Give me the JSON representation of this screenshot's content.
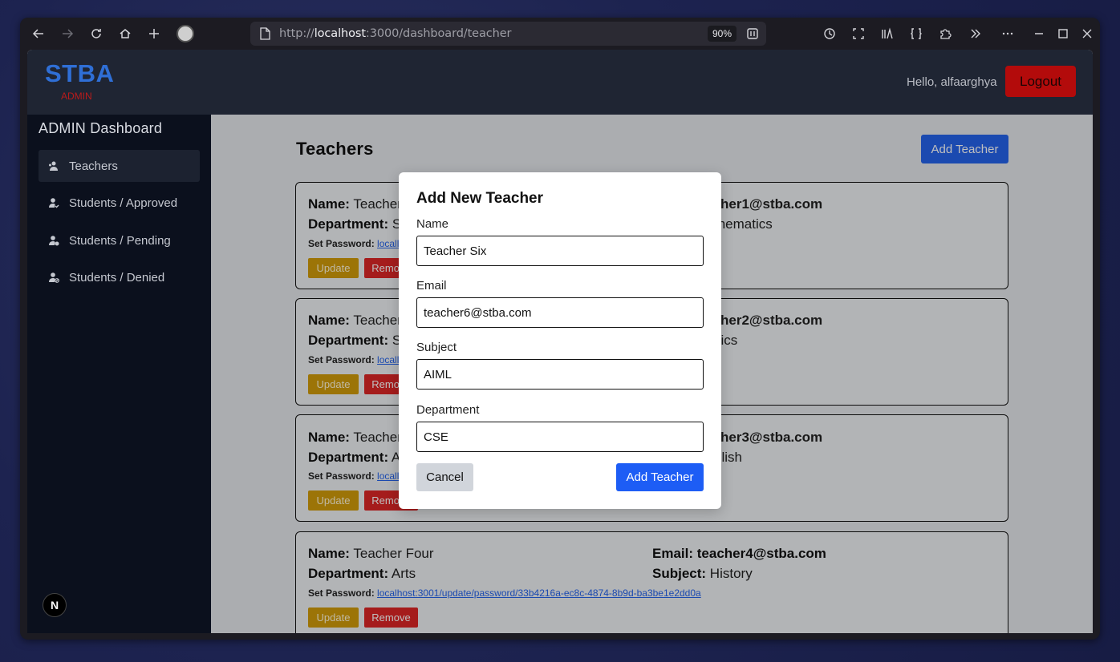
{
  "browser": {
    "url_scheme": "http://",
    "url_host": "localhost",
    "url_path": ":3000/dashboard/teacher",
    "zoom": "90%",
    "icons": [
      "back-arrow-icon",
      "forward-arrow-icon",
      "reload-icon",
      "home-icon",
      "new-tab-icon",
      "profile-avatar-icon",
      "page-icon",
      "reader-view-icon",
      "history-icon",
      "screenshot-icon",
      "library-icon",
      "dev-tools-icon",
      "extensions-icon",
      "overflow-icon",
      "menu-icon",
      "minimize-icon",
      "maximize-icon",
      "close-icon"
    ]
  },
  "header": {
    "logo": "STBA",
    "logo_sub": "ADMIN",
    "greeting": "Hello, alfaarghya",
    "logout_label": "Logout"
  },
  "sidebar": {
    "title": "ADMIN Dashboard",
    "items": [
      {
        "label": "Teachers",
        "icon": "teachers-icon",
        "active": true
      },
      {
        "label": "Students / Approved",
        "icon": "user-check-icon",
        "active": false
      },
      {
        "label": "Students / Pending",
        "icon": "user-clock-icon",
        "active": false
      },
      {
        "label": "Students / Denied",
        "icon": "user-block-icon",
        "active": false
      }
    ],
    "next_badge": "N"
  },
  "main": {
    "title": "Teachers",
    "add_button": "Add Teacher",
    "labels": {
      "name": "Name:",
      "department": "Department:",
      "email": "Email:",
      "subject": "Subject:",
      "set_password": "Set Password:",
      "update": "Update",
      "remove": "Remove"
    },
    "teachers": [
      {
        "name": "Teacher",
        "department": "Sc",
        "email": "her1@stba.com",
        "subject": "thematics",
        "link": "locall"
      },
      {
        "name": "Teacher",
        "department": "Sc",
        "email": "her2@stba.com",
        "subject": "sics",
        "link": "locall"
      },
      {
        "name": "Teacher",
        "department": "Ar",
        "email": "her3@stba.com",
        "subject": "glish",
        "link": "locall"
      },
      {
        "name": "Teacher Four",
        "department": "Arts",
        "email": "teacher4@stba.com",
        "subject": "History",
        "link": "localhost:3001/update/password/33b4216a-ec8c-4874-8b9d-ba3be1e2dd0a"
      }
    ]
  },
  "modal": {
    "title": "Add New Teacher",
    "name_label": "Name",
    "name_value": "Teacher Six",
    "email_label": "Email",
    "email_value": "teacher6@stba.com",
    "subject_label": "Subject",
    "subject_value": "AIML",
    "department_label": "Department",
    "department_value": "CSE",
    "cancel_label": "Cancel",
    "submit_label": "Add Teacher"
  }
}
